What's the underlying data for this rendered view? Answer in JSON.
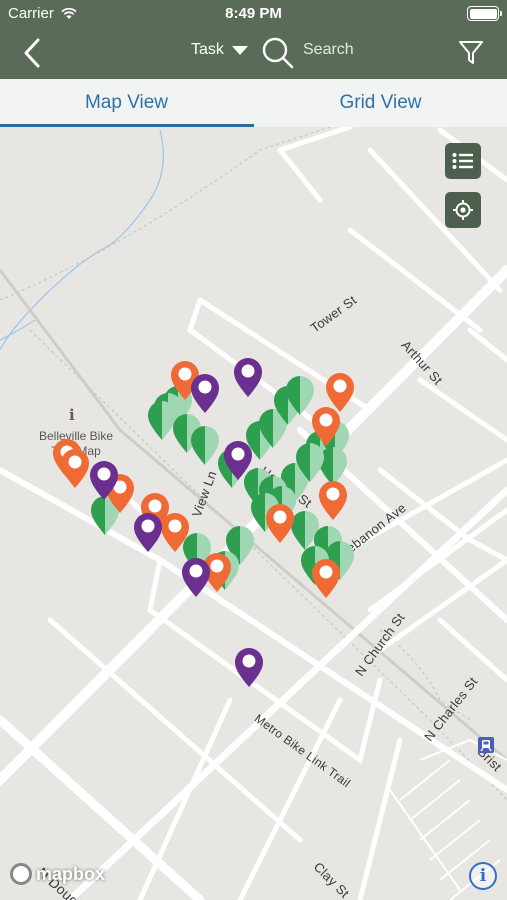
{
  "status": {
    "carrier": "Carrier",
    "time": "8:49 PM"
  },
  "nav": {
    "task_label": "Task",
    "search_placeholder": "Search"
  },
  "tabs": [
    {
      "label": "Map View",
      "active": true
    },
    {
      "label": "Grid View",
      "active": false
    }
  ],
  "map": {
    "poi": {
      "name_line1": "Belleville Bike",
      "name_line2": "Trail Map"
    },
    "streets": {
      "tower": "Tower St",
      "arthur": "Arthur St",
      "hecker": "Hecker St",
      "view": "View Ln",
      "lebanon": "Lebanon Ave",
      "church": "N Church St",
      "charles": "N Charles St",
      "metro": "Metro Bike Link Trail",
      "clay": "Clay St",
      "douglas": "N Douglas Ave",
      "bristol": "Brist"
    },
    "attribution": "mapbox",
    "colors": {
      "green": "#2e9e4f",
      "green_light": "#9fd7b2",
      "orange": "#f06a35",
      "purple": "#6a2f8f",
      "navbar": "#5a6b58",
      "tab_text": "#2f71a8"
    }
  }
}
